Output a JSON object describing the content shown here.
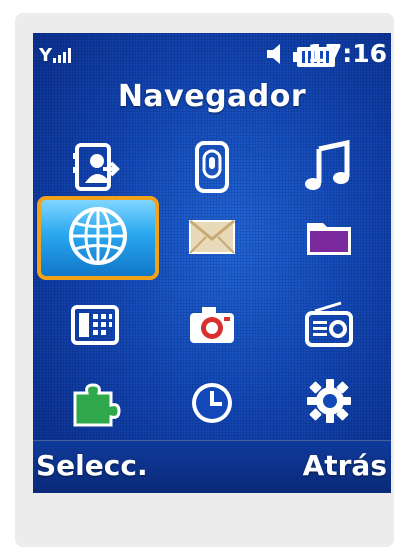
{
  "status": {
    "time": "17:16",
    "signal_icon": "signal-icon",
    "speaker_icon": "speaker-icon",
    "battery_icon": "battery-icon"
  },
  "screen": {
    "title": "Navegador"
  },
  "menu": {
    "items": [
      {
        "name": "contacts-icon"
      },
      {
        "name": "phone-icon"
      },
      {
        "name": "music-icon"
      },
      {
        "name": "browser-globe-icon",
        "selected": true
      },
      {
        "name": "messages-envelope-icon"
      },
      {
        "name": "files-folder-icon"
      },
      {
        "name": "calendar-icon"
      },
      {
        "name": "camera-icon"
      },
      {
        "name": "radio-icon"
      },
      {
        "name": "applications-puzzle-icon"
      },
      {
        "name": "clock-icon"
      },
      {
        "name": "settings-gear-icon"
      }
    ]
  },
  "softkeys": {
    "left": "Selecc.",
    "right": "Atrás"
  },
  "colors": {
    "screen_bg": "#1348b8",
    "selection_border": "#f0a31a",
    "text": "#ffffff"
  }
}
